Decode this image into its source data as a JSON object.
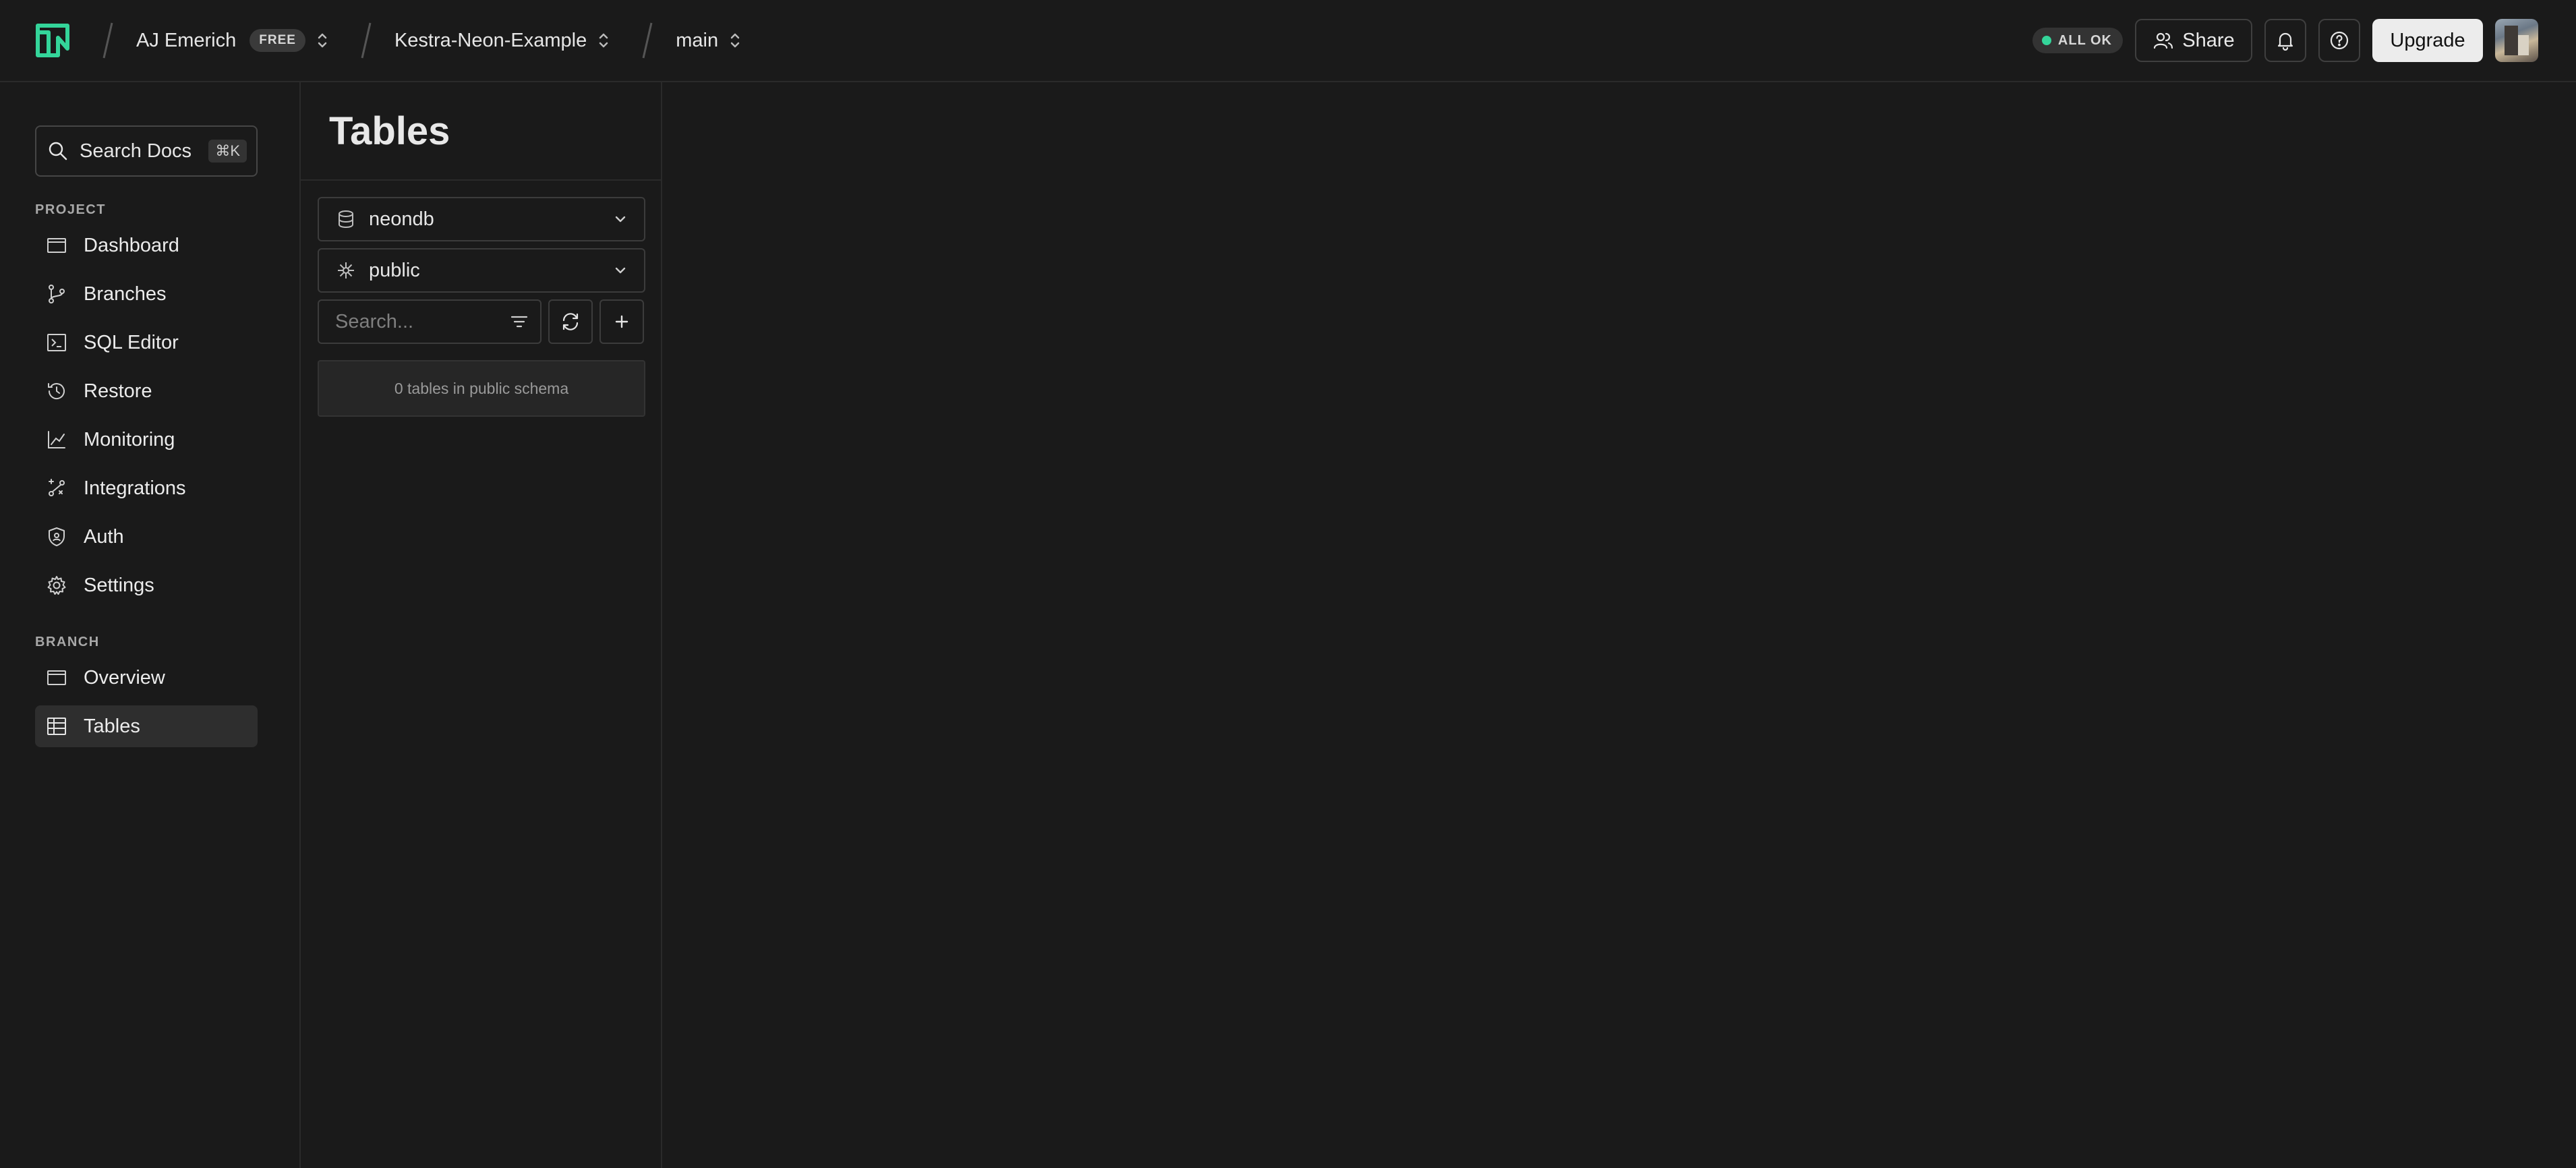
{
  "topbar": {
    "org_name": "AJ Emerich",
    "plan_badge": "FREE",
    "project_name": "Kestra-Neon-Example",
    "branch_name": "main",
    "status_text": "ALL OK",
    "status_color": "#34d59a",
    "share_label": "Share",
    "upgrade_label": "Upgrade",
    "brand_color": "#34d59a"
  },
  "sidebar": {
    "search": {
      "label": "Search Docs",
      "shortcut": "⌘K"
    },
    "project_section": "PROJECT",
    "project_items": [
      {
        "label": "Dashboard",
        "icon": "dashboard-icon"
      },
      {
        "label": "Branches",
        "icon": "branches-icon"
      },
      {
        "label": "SQL Editor",
        "icon": "sql-editor-icon"
      },
      {
        "label": "Restore",
        "icon": "restore-icon"
      },
      {
        "label": "Monitoring",
        "icon": "monitoring-icon"
      },
      {
        "label": "Integrations",
        "icon": "integrations-icon"
      },
      {
        "label": "Auth",
        "icon": "auth-icon"
      },
      {
        "label": "Settings",
        "icon": "settings-icon"
      }
    ],
    "branch_section": "BRANCH",
    "branch_items": [
      {
        "label": "Overview",
        "icon": "overview-icon"
      },
      {
        "label": "Tables",
        "icon": "tables-icon",
        "active": true
      }
    ]
  },
  "tables_panel": {
    "title": "Tables",
    "database_select": "neondb",
    "schema_select": "public",
    "search_placeholder": "Search...",
    "empty_message": "0 tables in public schema"
  }
}
